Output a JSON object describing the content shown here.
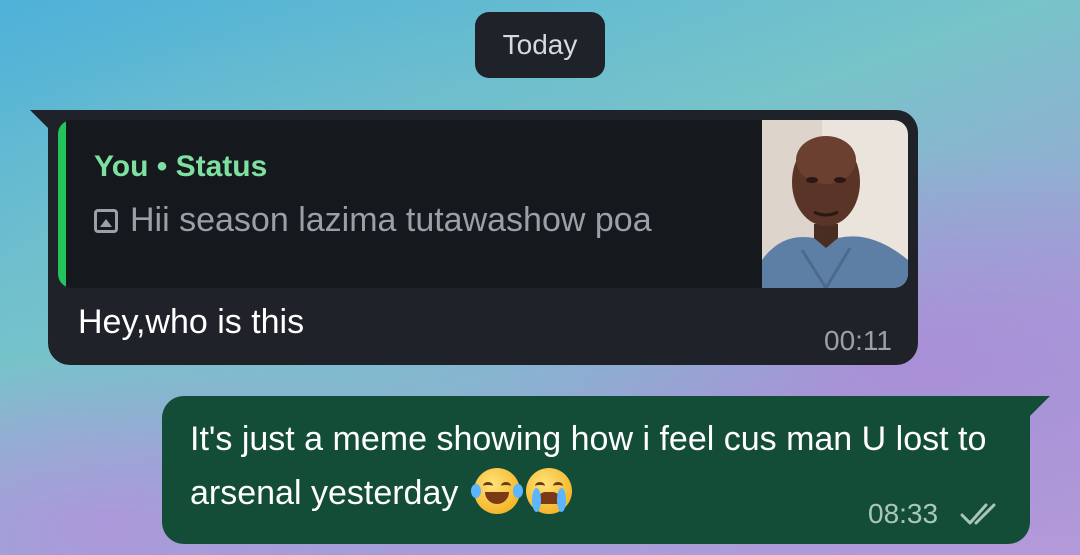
{
  "date_chip": "Today",
  "incoming": {
    "quote": {
      "author": "You • Status",
      "text": "Hii season lazima tutawashow poa",
      "icon": "image-icon"
    },
    "text": "Hey,who is this",
    "time": "00:11"
  },
  "outgoing": {
    "text": "It's just a meme showing how i feel cus man U lost to arsenal yesterday",
    "emojis": [
      "face-with-tears-of-joy",
      "loudly-crying-face"
    ],
    "time": "08:33",
    "status_icon": "double-check-icon"
  },
  "colors": {
    "incoming_bubble": "#1f2329",
    "outgoing_bubble": "#144d37",
    "quote_accent": "#23c45b",
    "quote_author": "#7ee0a0"
  }
}
